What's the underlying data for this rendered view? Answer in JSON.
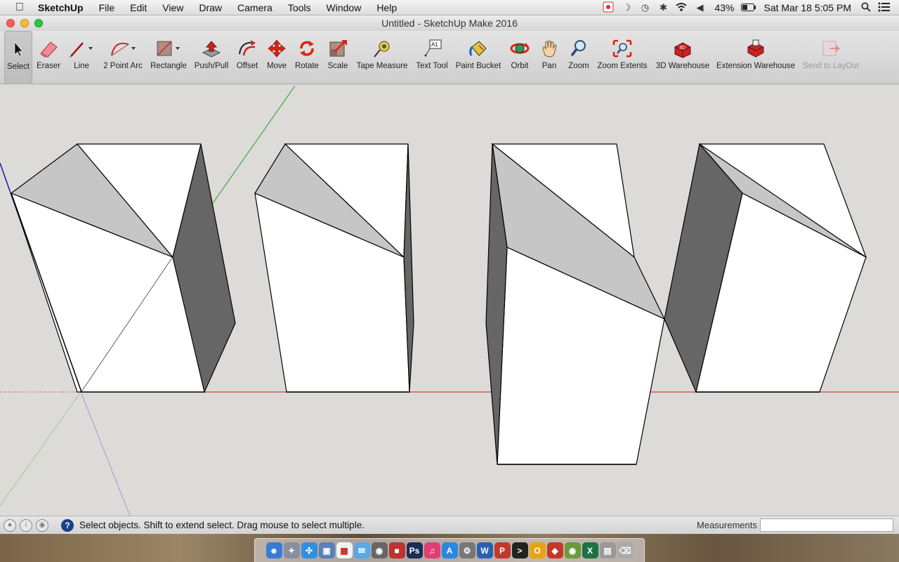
{
  "menubar": {
    "app_name": "SketchUp",
    "items": [
      "File",
      "Edit",
      "View",
      "Draw",
      "Camera",
      "Tools",
      "Window",
      "Help"
    ],
    "battery": "43%",
    "datetime": "Sat Mar 18  5:05 PM"
  },
  "window": {
    "title": "Untitled - SketchUp Make 2016"
  },
  "toolbar": {
    "tools": [
      {
        "label": "Select",
        "icon": "select-arrow-icon"
      },
      {
        "label": "Eraser",
        "icon": "eraser-icon"
      },
      {
        "label": "Line",
        "icon": "pencil-icon"
      },
      {
        "label": "2 Point Arc",
        "icon": "arc-icon"
      },
      {
        "label": "Rectangle",
        "icon": "rectangle-icon"
      },
      {
        "label": "Push/Pull",
        "icon": "push-pull-icon"
      },
      {
        "label": "Offset",
        "icon": "offset-icon"
      },
      {
        "label": "Move",
        "icon": "move-icon"
      },
      {
        "label": "Rotate",
        "icon": "rotate-icon"
      },
      {
        "label": "Scale",
        "icon": "scale-icon"
      },
      {
        "label": "Tape Measure",
        "icon": "tape-measure-icon"
      },
      {
        "label": "Text Tool",
        "icon": "text-tool-icon"
      },
      {
        "label": "Paint Bucket",
        "icon": "paint-bucket-icon"
      },
      {
        "label": "Orbit",
        "icon": "orbit-icon"
      },
      {
        "label": "Pan",
        "icon": "pan-hand-icon"
      },
      {
        "label": "Zoom",
        "icon": "zoom-icon"
      },
      {
        "label": "Zoom Extents",
        "icon": "zoom-extents-icon"
      },
      {
        "label": "3D Warehouse",
        "icon": "3d-warehouse-icon"
      },
      {
        "label": "Extension Warehouse",
        "icon": "extension-warehouse-icon"
      },
      {
        "label": "Send to LayOut",
        "icon": "send-to-layout-icon"
      }
    ],
    "text_tool_icon_text": "A1",
    "selected_tool": "Select",
    "disabled_tool": "Send to LayOut"
  },
  "statusbar": {
    "message": "Select objects. Shift to extend select. Drag mouse to select multiple.",
    "measurements_label": "Measurements",
    "measurements_value": ""
  },
  "colors": {
    "axis_red": "#c0201c",
    "axis_green": "#2a9a2a",
    "axis_blue": "#1a1ab0",
    "face_white": "#ffffff",
    "face_light_gray": "#c6c6c6",
    "face_dark_gray": "#666666",
    "viewport_bg": "#dcdbd8"
  }
}
